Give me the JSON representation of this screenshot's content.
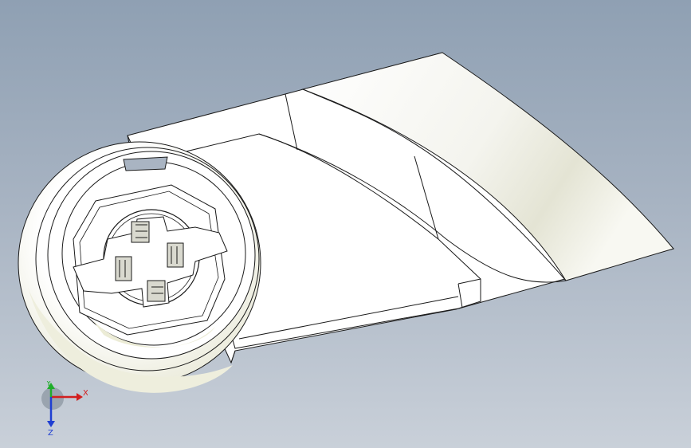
{
  "triad": {
    "x_label": "X",
    "y_label": "Y",
    "z_label": "Z"
  },
  "colors": {
    "background_top": "#8fa0b3",
    "background_bottom": "#c9d0d9",
    "part_face": "#ffffff",
    "part_shade": "#e6e6d8",
    "edge": "#1a1a1a",
    "axis_x": "#d21f1f",
    "axis_y": "#1fae2a",
    "axis_z": "#1f3fd2"
  }
}
